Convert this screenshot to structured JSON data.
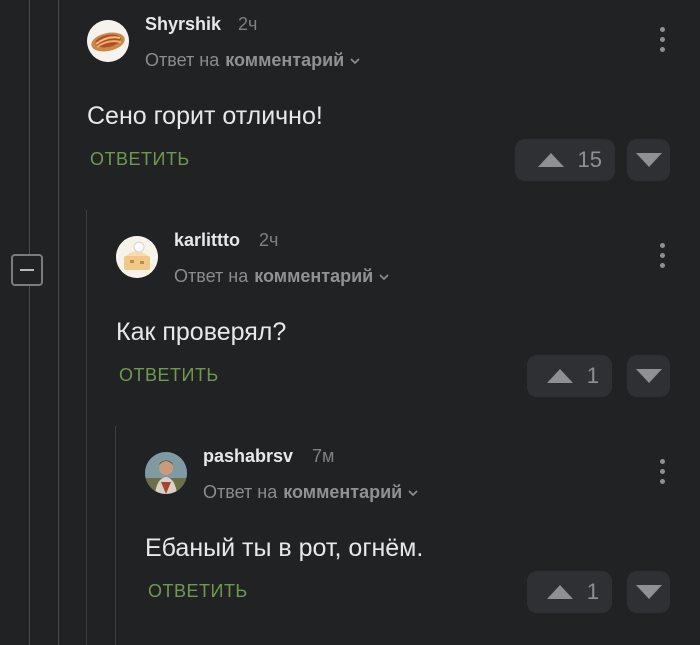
{
  "comments": [
    {
      "author": "Shyrshik",
      "time": "2ч",
      "reply_to_prefix": "Ответ на",
      "reply_to_link": "комментарий",
      "text": "Сено горит отлично!",
      "reply_label": "ОТВЕТИТЬ",
      "rating": "15"
    },
    {
      "author": "karlittto",
      "time": "2ч",
      "reply_to_prefix": "Ответ на",
      "reply_to_link": "комментарий",
      "text": "Как проверял?",
      "reply_label": "ОТВЕТИТЬ",
      "rating": "1"
    },
    {
      "author": "pashabrsv",
      "time": "7м",
      "reply_to_prefix": "Ответ на",
      "reply_to_link": "комментарий",
      "text": "Ебаный ты в рот, огнём.",
      "reply_label": "ОТВЕТИТЬ",
      "rating": "1"
    }
  ],
  "icons": {
    "collapse": "minus-icon",
    "upvote": "upvote-icon",
    "downvote": "downvote-icon",
    "more": "more-vertical-icon",
    "expand": "chevron-down-icon"
  },
  "colors": {
    "background": "#212224",
    "accent_reply": "#6e9a4e",
    "vote_bg": "#2f3033"
  }
}
